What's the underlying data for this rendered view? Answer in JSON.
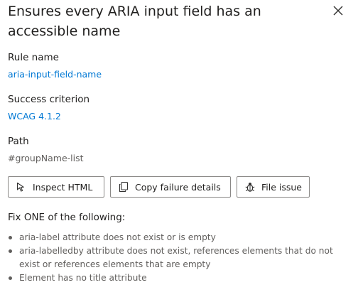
{
  "panel": {
    "title": "Ensures every ARIA input field has an accessible name"
  },
  "rule": {
    "label": "Rule name",
    "value": "aria-input-field-name"
  },
  "criterion": {
    "label": "Success criterion",
    "value": "WCAG 4.1.2"
  },
  "path": {
    "label": "Path",
    "value": "#groupName-list"
  },
  "buttons": {
    "inspect": "Inspect HTML",
    "copy": "Copy failure details",
    "file": "File issue"
  },
  "fix": {
    "heading": "Fix ONE of the following:",
    "items": [
      "aria-label attribute does not exist or is empty",
      "aria-labelledby attribute does not exist, references elements that do not exist or references elements that are empty",
      "Element has no title attribute"
    ]
  },
  "icons": {
    "close": "close-icon",
    "inspect": "inspect-icon",
    "copy": "copy-icon",
    "file": "bug-icon"
  },
  "colors": {
    "link": "#0078d4",
    "text": "#201f1e",
    "secondary_text": "#605e5c",
    "border": "#8a8886"
  }
}
